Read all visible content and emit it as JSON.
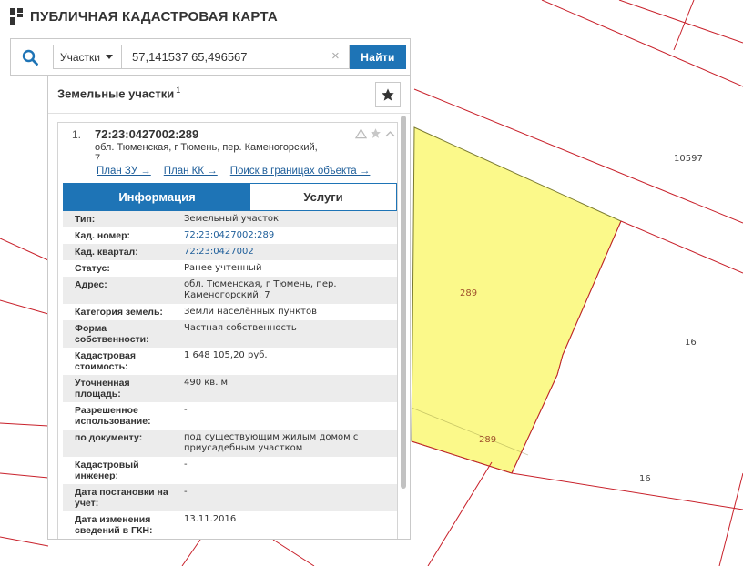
{
  "header": {
    "title": "ПУБЛИЧНАЯ КАДАСТРОВАЯ КАРТА"
  },
  "search": {
    "type_label": "Участки",
    "query": "57,141537 65,496567",
    "clear_glyph": "×",
    "find_label": "Найти"
  },
  "panel": {
    "title": "Земельные участки",
    "count": "1"
  },
  "result": {
    "number": "1.",
    "cad_number": "72:23:0427002:289",
    "address_line1": "обл. Тюменская, г Тюмень, пер. Каменогорский,",
    "address_line2": "7",
    "links": [
      "План ЗУ →",
      "План КК →",
      "Поиск в границах объекта →"
    ],
    "tabs": {
      "info": "Информация",
      "services": "Услуги"
    },
    "rows": [
      {
        "k": "Тип:",
        "v": "Земельный участок",
        "link": false
      },
      {
        "k": "Кад. номер:",
        "v": "72:23:0427002:289",
        "link": true
      },
      {
        "k": "Кад. квартал:",
        "v": "72:23:0427002",
        "link": true
      },
      {
        "k": "Статус:",
        "v": "Ранее учтенный",
        "link": false
      },
      {
        "k": "Адрес:",
        "v": "обл. Тюменская, г Тюмень, пер. Каменогорский, 7",
        "link": false
      },
      {
        "k": "Категория земель:",
        "v": "Земли населённых пунктов",
        "link": false
      },
      {
        "k": "Форма собственности:",
        "v": "Частная собственность",
        "link": false
      },
      {
        "k": "Кадастровая стоимость:",
        "v": "1 648 105,20 руб.",
        "link": false
      },
      {
        "k": "Уточненная площадь:",
        "v": "490 кв. м",
        "link": false
      },
      {
        "k": "Разрешенное использование:",
        "v": "-",
        "link": false
      },
      {
        "k": "по документу:",
        "v": "под существующим жилым домом с приусадебным участком",
        "link": false
      },
      {
        "k": "Кадастровый инженер:",
        "v": "-",
        "link": false
      },
      {
        "k": "Дата постановки на учет:",
        "v": "-",
        "link": false
      },
      {
        "k": "Дата изменения сведений в ГКН:",
        "v": "13.11.2016",
        "link": false
      }
    ]
  },
  "map": {
    "labels": {
      "parcel_a": "289",
      "parcel_b": "289",
      "n10597": "10597",
      "n16a": "16",
      "n16b": "16"
    },
    "colors": {
      "boundary": "#c8202a",
      "highlight_fill": "#fbf98a",
      "highlight_stroke": "#7a7a30",
      "accent": "#1e74b6"
    }
  }
}
